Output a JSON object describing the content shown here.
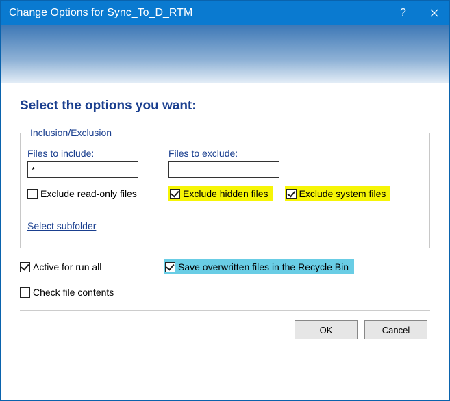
{
  "title": "Change Options for Sync_To_D_RTM",
  "heading": "Select the options you want:",
  "group": {
    "legend": "Inclusion/Exclusion",
    "include_label": "Files to include:",
    "include_value": "*",
    "exclude_label": "Files to exclude:",
    "exclude_value": "",
    "exclude_readonly": {
      "label": "Exclude read-only files",
      "checked": false
    },
    "exclude_hidden": {
      "label": "Exclude hidden files",
      "checked": true
    },
    "exclude_system": {
      "label": "Exclude system files",
      "checked": true
    },
    "select_subfolder": "Select subfolder"
  },
  "active_run_all": {
    "label": "Active for run all",
    "checked": true
  },
  "save_recycle": {
    "label": "Save overwritten files in the Recycle Bin",
    "checked": true
  },
  "check_file_contents": {
    "label": "Check file contents",
    "checked": false
  },
  "buttons": {
    "ok": "OK",
    "cancel": "Cancel"
  }
}
